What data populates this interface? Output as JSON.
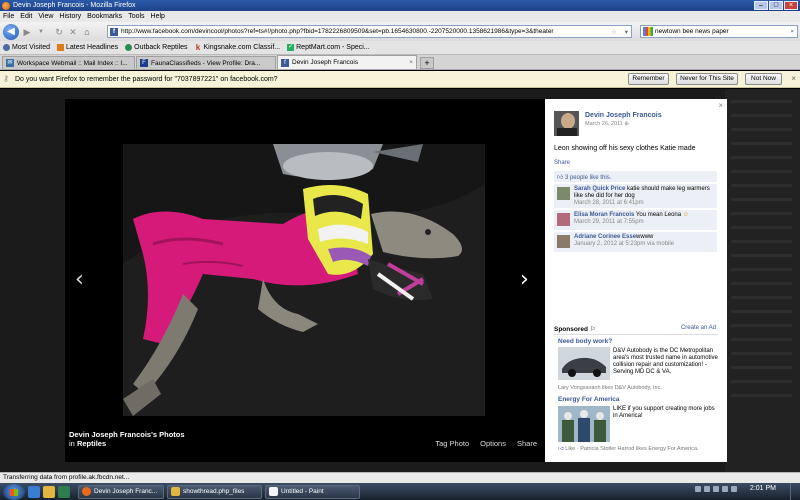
{
  "window": {
    "title": "Devin Joseph Francois - Mozilla Firefox"
  },
  "menu": [
    "File",
    "Edit",
    "View",
    "History",
    "Bookmarks",
    "Tools",
    "Help"
  ],
  "nav": {
    "url": "http://www.facebook.com/devincool/photos?ref=ts#!/photo.php?fbid=1782226809509&set=pb.1654630800.-2207520000.1358621986&type=3&theater",
    "search_query": "newtown bee news paper"
  },
  "bookmarks": [
    {
      "label": "Most Visited",
      "icon": "gear-icon",
      "color": "#4a6aa0"
    },
    {
      "label": "Latest Headlines",
      "icon": "rss-icon",
      "color": "#e07b1a"
    },
    {
      "label": "Outback Reptiles",
      "icon": "globe-icon",
      "color": "#2e8b57"
    },
    {
      "label": "Kingsnake.com Classif...",
      "icon": "k-logo-icon",
      "color": "#c0392b"
    },
    {
      "label": "ReptMart.com - Speci...",
      "icon": "reptmart-icon",
      "color": "#27ae60"
    }
  ],
  "tabs": [
    {
      "label": "Workspace Webmail :: Mail Index :: I...",
      "icon_color": "#3a6ea5",
      "active": false
    },
    {
      "label": "FaunaClassifieds - View Profile: Dra...",
      "icon_color": "#1d3c8a",
      "active": false
    },
    {
      "label": "Devin Joseph Francois",
      "icon_color": "#3b5998",
      "active": true
    }
  ],
  "notification": {
    "text": "Do you want Firefox to remember the password for \"7037897221\" on facebook.com?",
    "remember": "Remember",
    "never": "Never for This Site",
    "not_now": "Not Now"
  },
  "viewer": {
    "caption_owner": "Devin Joseph Francois's Photos",
    "caption_in": "in",
    "caption_album": "Reptiles",
    "actions": [
      "Tag Photo",
      "Options",
      "Share"
    ]
  },
  "sidebar": {
    "author": "Devin Joseph Francois",
    "date": "March 26, 2011",
    "description": "Leon showing off his sexy clothes Katie made",
    "share": "Share",
    "likes": "3 people like this.",
    "comments": [
      {
        "name": "Sarah Quick Price",
        "text": "katie should make leg warmers like she did for her dog",
        "time": "March 28, 2011 at 6:41pm"
      },
      {
        "name": "Elisa Moran Francois",
        "text": "You mean Leona ",
        "emoji": "☺",
        "time": "March 29, 2011 at 7:55pm"
      },
      {
        "name": "Adriane Corinee Esse",
        "text": "wwww",
        "time": "January 2, 2012 at 5:23pm via mobile"
      }
    ],
    "sponsored": "Sponsored",
    "create_ad": "Create an Ad",
    "ads": [
      {
        "title": "Need body work?",
        "body": "D&V Autobody is the DC Metropolitan area's most trusted name in automotive collision repair and customization! - Serving MD DC & VA.",
        "social": "Lary Vongsavanh likes D&V Autobody, Inc."
      },
      {
        "title": "Energy For America",
        "body": "LIKE if you support creating more jobs in America!",
        "social": "Like · Patricia Stotler Harrod likes Energy For America."
      }
    ]
  },
  "status": "Transferring data from profile.ak.fbcdn.net...",
  "taskbar": {
    "buttons": [
      "Devin Joseph Franc...",
      "showthread.php_files",
      "Untitled - Paint"
    ],
    "clock": "2:01 PM"
  }
}
